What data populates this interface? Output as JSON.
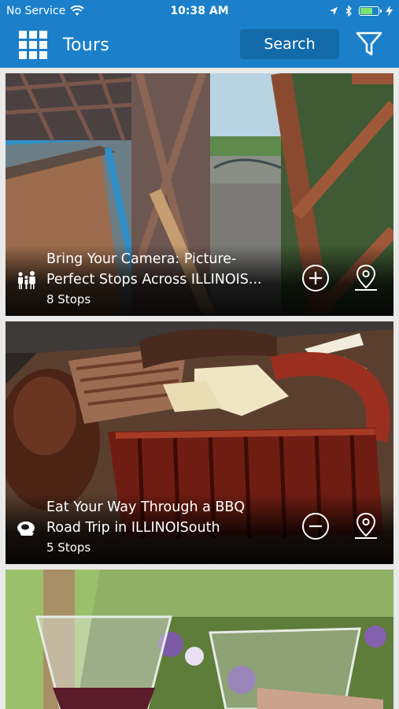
{
  "status_bar": {
    "carrier": "No Service",
    "time": "10:38 AM",
    "battery_level": 0.7
  },
  "nav": {
    "title": "Tours",
    "search_label": "Search",
    "menu_icon": "grid-menu-icon",
    "filter_icon": "filter-funnel-icon"
  },
  "colors": {
    "nav_blue": "#1b80c9",
    "search_button_blue": "#126aa9"
  },
  "tours": [
    {
      "title_line1": "Bring Your Camera: Picture-",
      "title_line2": "Perfect Stops Across ILLINOIS...",
      "stops": "8 Stops",
      "category_icon": "family-icon",
      "action": "add",
      "action_icon": "plus-circle-icon",
      "map_icon": "map-pin-icon"
    },
    {
      "title_line1": "Eat Your Way Through a BBQ",
      "title_line2": "Road Trip in ILLINOISouth",
      "stops": "5 Stops",
      "category_icon": "food-icon",
      "action": "remove",
      "action_icon": "minus-circle-icon",
      "map_icon": "map-pin-icon"
    },
    {
      "title_line1": "",
      "title_line2": "",
      "stops": "",
      "category_icon": "",
      "action": "",
      "action_icon": "",
      "map_icon": ""
    }
  ]
}
